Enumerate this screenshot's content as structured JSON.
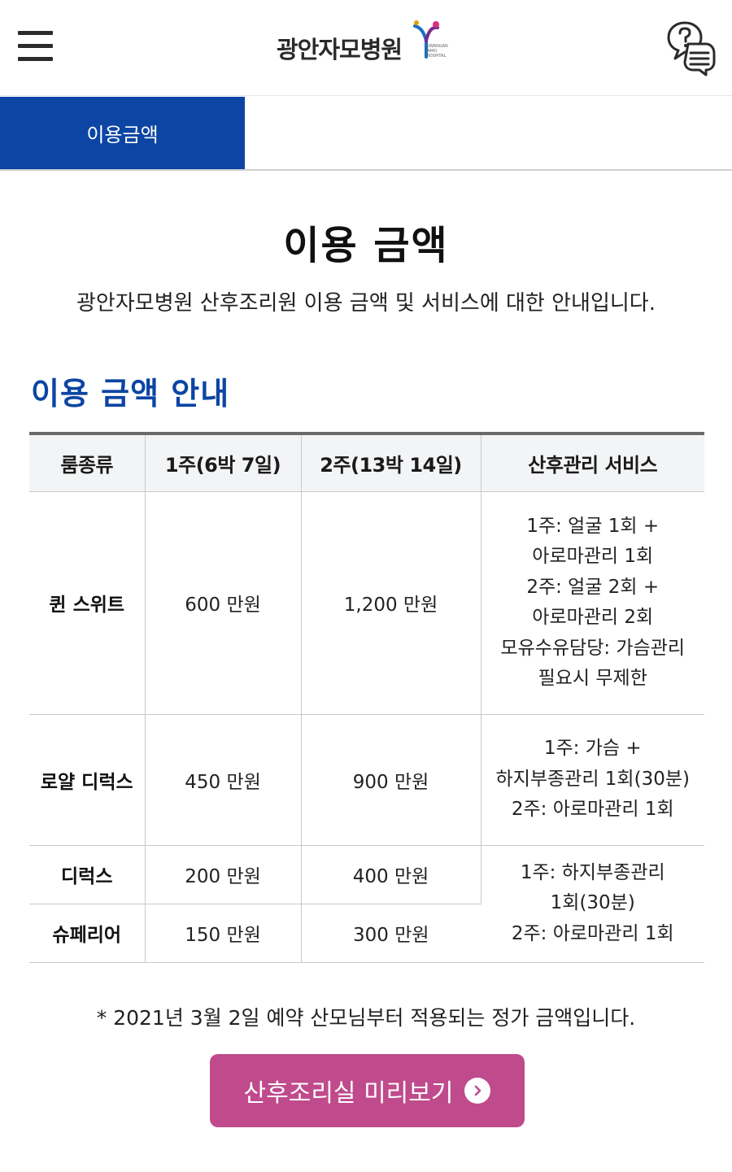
{
  "header": {
    "logo_text": "광안자모병원",
    "logo_sub": [
      "GWANGAN",
      "JAMO",
      "HOSPITAL"
    ]
  },
  "tabs": [
    {
      "label": "이용금액",
      "active": true
    }
  ],
  "page": {
    "title": "이용 금액",
    "description": "광안자모병원 산후조리원 이용 금액 및 서비스에 대한 안내입니다."
  },
  "section": {
    "title": "이용 금액 안내"
  },
  "table": {
    "headers": [
      "룸종류",
      "1주(6박 7일)",
      "2주(13박 14일)",
      "산후관리 서비스"
    ],
    "rows": [
      {
        "room": "퀸 스위트",
        "week1": "600 만원",
        "week2": "1,200 만원",
        "service": [
          "1주: 얼굴 1회 +",
          "아로마관리 1회",
          "2주: 얼굴 2회 +",
          "아로마관리 2회",
          "모유수유담당: 가슴관리",
          "필요시 무제한"
        ]
      },
      {
        "room": "로얄 디럭스",
        "week1": "450 만원",
        "week2": "900 만원",
        "service": [
          "1주: 가슴 +",
          "하지부종관리 1회(30분)",
          "2주: 아로마관리 1회"
        ]
      },
      {
        "room": "디럭스",
        "week1": "200 만원",
        "week2": "400 만원",
        "service": [
          "1주: 하지부종관리",
          "1회(30분)",
          "2주: 아로마관리 1회"
        ]
      },
      {
        "room": "슈페리어",
        "week1": "150 만원",
        "week2": "300 만원"
      }
    ]
  },
  "notice": "* 2021년 3월 2일 예약 산모님부터 적용되는 정가 금액입니다.",
  "preview_button": {
    "label": "산후조리실 미리보기"
  },
  "colors": {
    "primary_blue": "#0c45a3",
    "button_pink": "#bf4b8c",
    "header_bg": "#f3f4f6"
  }
}
